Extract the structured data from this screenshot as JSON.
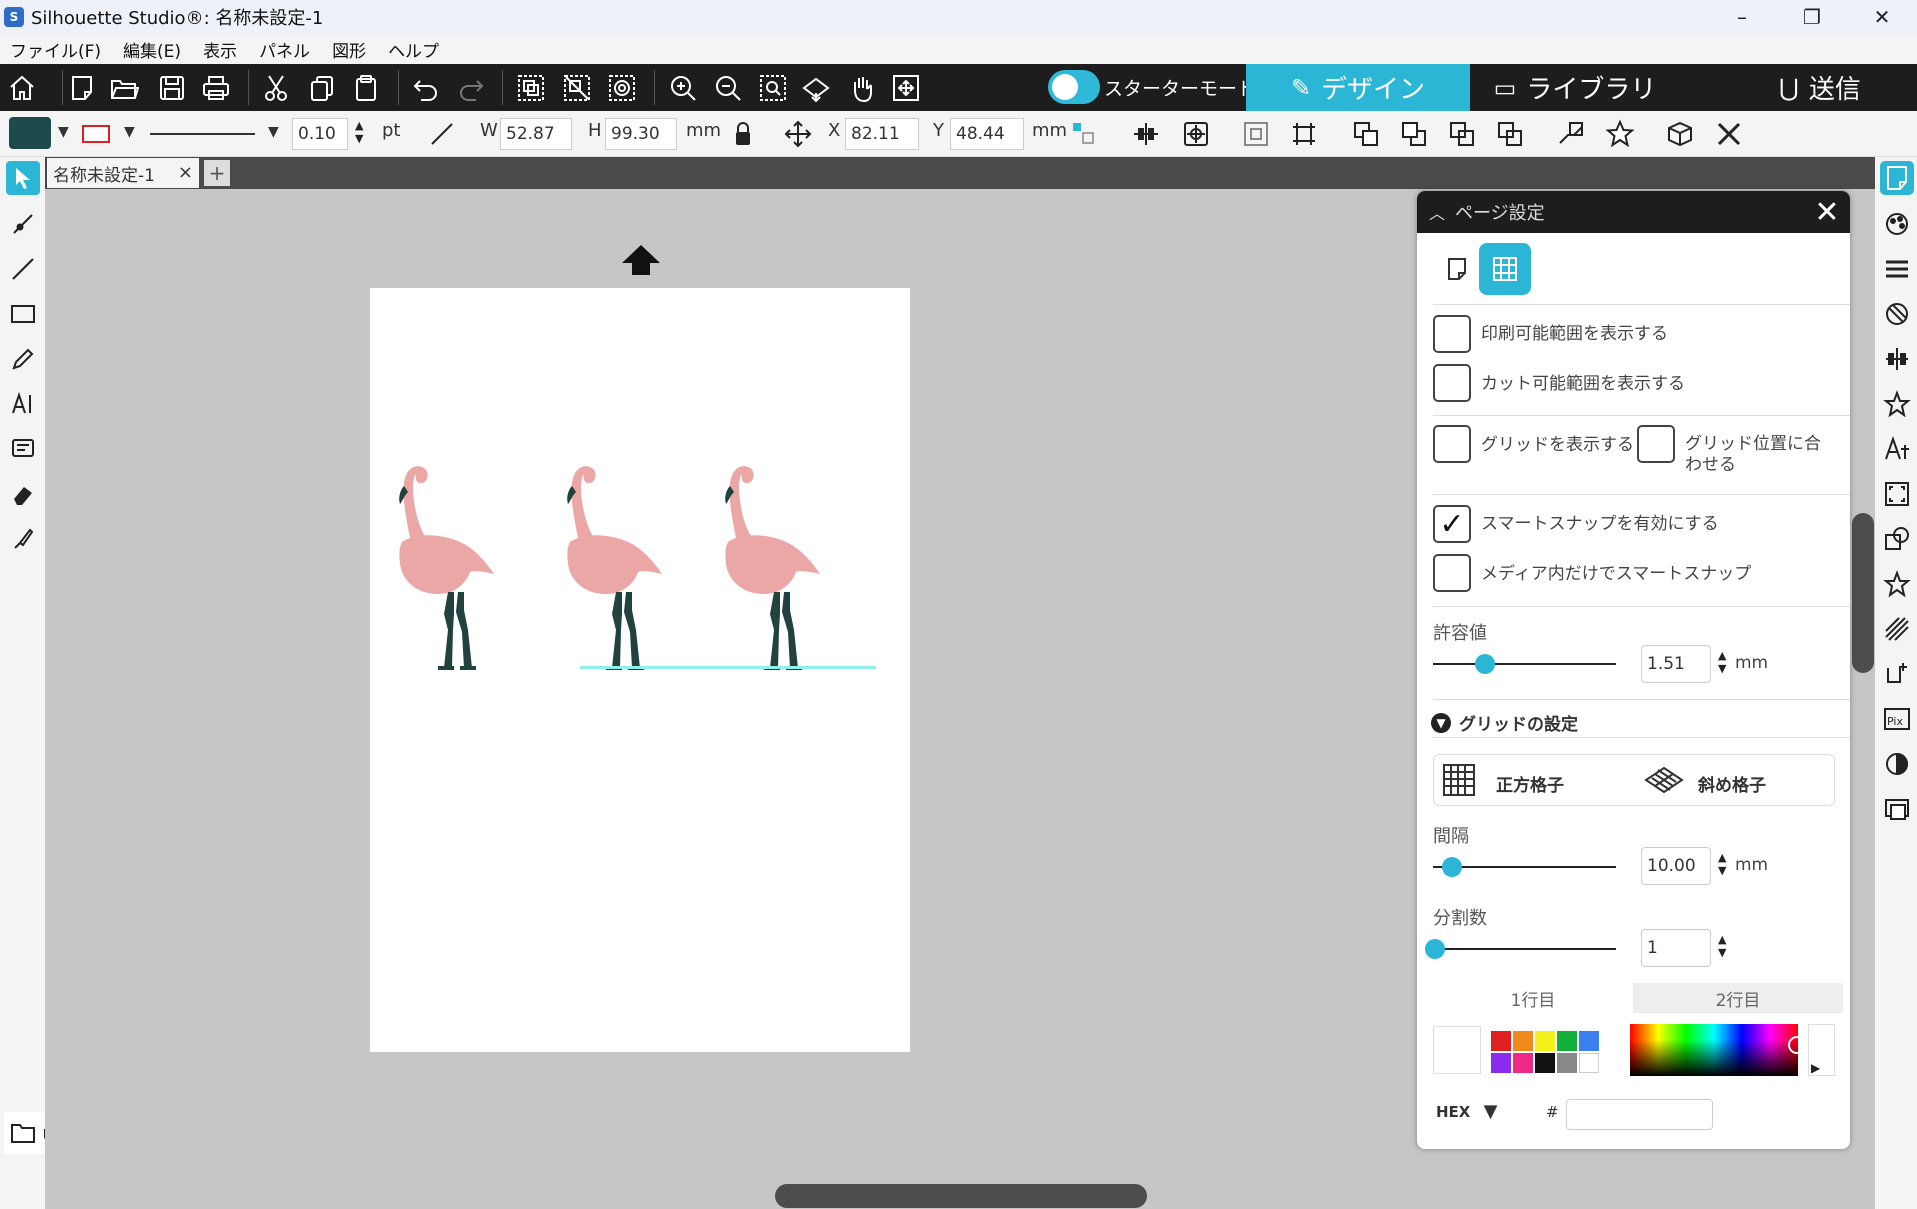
{
  "window": {
    "title": "Silhouette Studio®: 名称未設定-1",
    "icon_letter": "S",
    "minimize_icon": "–",
    "maximize_icon": "❐",
    "close_icon": "✕"
  },
  "menu": [
    "ファイル(F)",
    "編集(E)",
    "表示",
    "パネル",
    "図形",
    "ヘルプ"
  ],
  "toolbar": {
    "starter_mode_label": "スターターモードオフ",
    "starter_mode_on": false,
    "tabs": [
      {
        "label": "デザイン",
        "icon": "design-icon",
        "glyph": "✎",
        "active": true
      },
      {
        "label": "ライブラリ",
        "icon": "folder-icon",
        "glyph": "▭",
        "active": false
      },
      {
        "label": "送信",
        "icon": "send-icon",
        "glyph": "⋃",
        "active": false
      }
    ]
  },
  "properties": {
    "line_width": "0.10",
    "line_unit": "pt",
    "w_label": "W",
    "w_value": "52.87",
    "h_label": "H",
    "h_value": "99.30",
    "size_unit": "mm",
    "x_label": "X",
    "x_value": "82.11",
    "y_label": "Y",
    "y_value": "48.44",
    "pos_unit": "mm",
    "fill_color": "#1d4a4c",
    "line_color": "#e02020"
  },
  "document": {
    "tab_label": "名称未設定-1",
    "close_glyph": "×",
    "add_glyph": "+"
  },
  "canvas": {
    "flamingo_count": 3,
    "flamingo_body_color": "#eba7a5",
    "flamingo_leg_color": "#21423e",
    "highlight_line_color": "#8ff0ee"
  },
  "panel": {
    "title": "ページ設定",
    "close_glyph": "✕",
    "checkboxes": [
      {
        "label": "印刷可能範囲を表示する",
        "checked": false
      },
      {
        "label": "カット可能範囲を表示する",
        "checked": false
      },
      {
        "label": "グリッドを表示する",
        "checked": false
      },
      {
        "label": "グリッド位置に合わせる",
        "checked": false
      },
      {
        "label": "スマートスナップを有効にする",
        "checked": true
      },
      {
        "label": "メディア内だけでスマートスナップ",
        "checked": false
      }
    ],
    "check_glyph": "✓",
    "tolerance": {
      "label": "許容値",
      "value": "1.51",
      "unit": "mm"
    },
    "grid_section": {
      "title": "グリッドの設定",
      "square_label": "正方格子",
      "diagonal_label": "斜め格子"
    },
    "spacing": {
      "label": "間隔",
      "value": "10.00",
      "unit": "mm"
    },
    "divisions": {
      "label": "分割数",
      "value": "1"
    },
    "row_tabs": [
      "1行目",
      "2行目"
    ],
    "swatches": [
      "#e02020",
      "#ef8a1c",
      "#f5f01a",
      "#12b03a",
      "#3a7ff0",
      "#8a2cf0",
      "#ee2a87",
      "#111111",
      "#888888",
      "#ffffff"
    ],
    "hex_label": "HEX",
    "hex_hash": "#",
    "hex_value": ""
  },
  "accent_color": "#2cb6d6"
}
